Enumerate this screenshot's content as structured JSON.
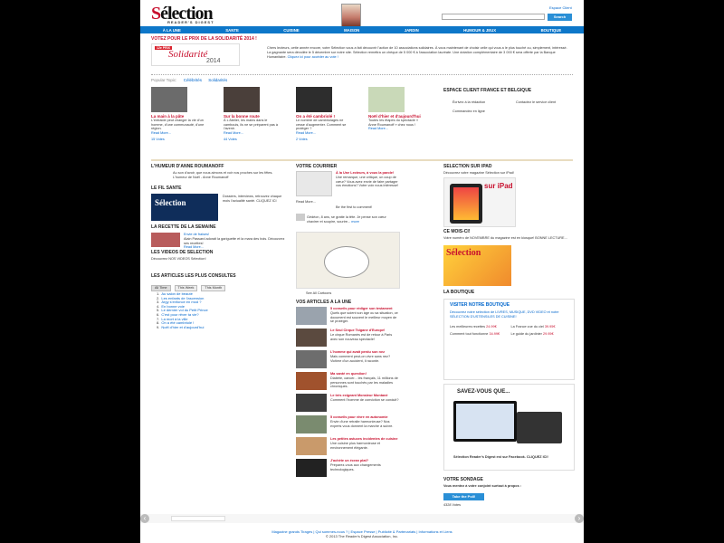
{
  "header": {
    "logo_text": "Sélection",
    "logo_sub": "READER'S DIGEST",
    "espace": "Espace Client",
    "search_placeholder": "",
    "search_label": "Search"
  },
  "nav": [
    "À LA UNE",
    "SANTE",
    "CUISINE",
    "MAISON",
    "JARDIN",
    "HUMOUR & JEUX",
    "BOUTIQUE"
  ],
  "vote": {
    "title": "VOTEZ POUR LE PRIX DE LA SOLIDARITÉ 2014 !",
    "banner_tag": "12e PRIX",
    "banner_word": "Solidarité",
    "banner_year": "2014",
    "text": "Chers lecteurs, cette année encore, votre Sélection vous a fait découvrir l'action de 10 associations solidaires. À vous maintenant de choisir celle qui vous a le plus touché ou, simplement, intéressé. La gagnante sera dévoilée le 5 décembre sur notre site. Sélection remettra un chèque de 5 000 € à l'association lauréate. Une dotation complémentaire de 3 000 € sera offerte par la Banque Humanitaire.",
    "link": "Cliquez ici pour accéder au vote !"
  },
  "popular": {
    "label": "Popular Topic:",
    "links": [
      "Célébrités",
      "Solidarités"
    ]
  },
  "cards": [
    {
      "title": "La main à la pâte",
      "text": "L'entraide peut changer la vie d'un homme, d'une communauté, d'une région.",
      "more": "Read More...",
      "votes": "15 Votes"
    },
    {
      "title": "Sur la bonne route",
      "text": "À L'Atelier, les mains dans le cambouis, ils ne se préparent pas à l'avenir.",
      "more": "Read More...",
      "votes": "44 Votes"
    },
    {
      "title": "On a été cambriolé !",
      "text": "Le nombre de cambriolages ne cesse d'augmenter. Comment se protéger ?",
      "more": "Read More...",
      "votes": "2 Votes"
    },
    {
      "title": "Noël d'hier et d'aujourd'hui",
      "text": "Toutes les étapes du spectacle « Anne Roumanoff » chez nous !",
      "more": "Read More...",
      "votes": ""
    }
  ],
  "espace_client": {
    "title": "ESPACE CLIENT FRANCE ET BELGIQUE",
    "links": [
      "Écrivez à la rédaction",
      "Contactez le service client",
      "Commandez en ligne"
    ]
  },
  "humeur": {
    "title": "L'HUMEUR D'ANNE ROUMANOFF",
    "text": "Au son d'avoir, que nous aimons et voir nos proches sur les fêtes. L'humeur de Noël - Anne Roumanoff"
  },
  "fil_sante": {
    "title": "LE FIL SANTE",
    "text": "Dossiers, interviews, retrouvez chaque mois l'actualité santé. CLIQUEZ ICI"
  },
  "recette": {
    "title": "LA RECETTE DE LA SEMAINE",
    "name": "Envie de fraises!",
    "text": "Alain Passard adorait la gariguette et la mara des bois. Découvrez ses recettes!",
    "more": "Read More..."
  },
  "videos": {
    "title": "LES VIDEOS DE SELECTION",
    "text": "Découvrez NOS VIDEOS Sélection!"
  },
  "consultes": {
    "title": "LES ARTICLES LES PLUS CONSULTES",
    "tabs": [
      "All Time",
      "This Week",
      "This Month"
    ],
    "items": [
      "Au salon de beauté",
      "Les enfants de l'ascension",
      "Argy s'enfonce en mod ?",
      "En bonne voie",
      "Le dernier vol du Petit Prince",
      "C'est pour rêver ta vie?",
      "La mort à la ville",
      "On a été cambriolé !",
      "Noël d'hier et d'aujourd'hui"
    ]
  },
  "courrier": {
    "title": "VOTRE COURRIER",
    "item_title": "À la Une Lecteurs, à vous la parole!",
    "item_text": "Une remarque, une critique, un coup de cœur? Vous avez envie de faire partager vos émotions? Votre voix nous intéresse!",
    "more": "Read More...",
    "vote": "Be the first to comment!",
    "quote": "Gédéon, 8 ans, se gratte la tête. Je pense son cœur chavirer et soupire, sourire...",
    "quote_more": "more"
  },
  "cartoons": {
    "see_all": "See All Cartoons"
  },
  "une": {
    "title": "VOS ARTICLES A LA UNE",
    "items": [
      {
        "title": "5 conseils pour rédiger son testament",
        "text": "Quels que soient son âge ou sa situation, ce document est souvent le meilleur moyen de se protéger."
      },
      {
        "title": "Le Seul Cirque Tsigane d'Europe!",
        "text": "Le cirque Romanès est de retour à Paris avec son nouveau spectacle!"
      },
      {
        "title": "L'homme qui avait perdu son nez",
        "text": "Mais comment peut-on vivre sans nez? Victime d'un accident, il raconte."
      },
      {
        "title": "Ma santé en question!",
        "text": "Diabète, cancer... les français, 11 millions de personnes sont touchés par les maladies chroniques."
      },
      {
        "title": "Le très exigeant Monsieur Montané",
        "text": "Comment l'homme de conviction se conduit?"
      },
      {
        "title": "5 conseils pour vivre en autonomie",
        "text": "Envie d'une retraite harmonieuse? Nos experts vous donnent la marche à suivre."
      },
      {
        "title": "Les petites astuces incidentes de cuisine",
        "text": "Une cuisine plus harmonieuse et environnement élégante."
      },
      {
        "title": "J'achète un écran plat?",
        "text": "Préparez-vous aux changements technologiques."
      }
    ]
  },
  "ipad": {
    "title": "SELECTION SUR IPAD",
    "text": "Découvrez votre magazine Sélection sur iPad!",
    "ipad_word": "sur iPad"
  },
  "ce_mois": {
    "title": "CE MOIS-CI!",
    "text": "Votre numéro de NOVEMBRE du magazine est en kiosque! BONNE LECTURE..."
  },
  "boutique": {
    "title": "LA BOUTIQUE",
    "visit": "VISITER NOTRE BOUTIQUE",
    "text": "Découvrez notre sélection de LIVRES, MUSIQUE, DVD VIDEO et notre SÉLECTION D'USTENSILES DE CUISINE!",
    "products": [
      {
        "name": "Les meilleures recettes",
        "price": "24.99€"
      },
      {
        "name": "La France vue du ciel",
        "price": "39.95€"
      },
      {
        "name": "Comment tout fonctionne",
        "price": "34.99€"
      },
      {
        "name": "Le guide du jardinier",
        "price": "29.95€"
      }
    ]
  },
  "savez_vous": {
    "title": "SAVEZ-VOUS QUE...",
    "text": "Sélection Reader's Digest est sur Facebook. CLIQUEZ ICI!"
  },
  "sondage": {
    "title": "VOTRE SONDAGE",
    "question": "Vous mentez à votre conjoint surtout à propos :",
    "button": "Take the Poll!",
    "votes": "4328 Votes"
  },
  "footer": {
    "links": "Magazine grands Tirages | Qui sommes-nous ? | Espace Presse | Publicité & Partenariats | Informations et Liens",
    "copyright": "© 2013 The Reader's Digest Association, Inc."
  },
  "carousel": {
    "prev": "‹",
    "next": "›"
  },
  "colors": {
    "accent": "#0d77c9",
    "brand_red": "#c8102e",
    "link": "#0066cc"
  }
}
